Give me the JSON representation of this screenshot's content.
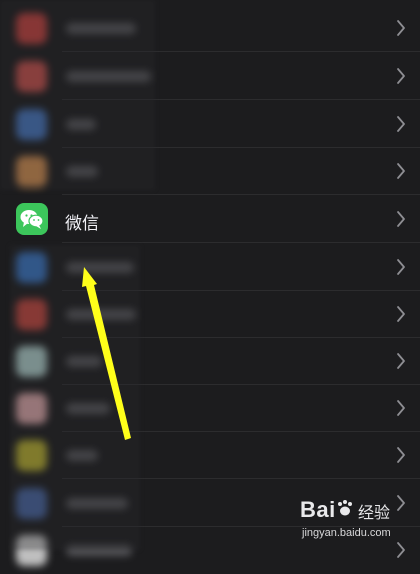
{
  "settings_list": {
    "rows": [
      {
        "kind": "blurred",
        "icon_color": "#d64541",
        "label_width": 70
      },
      {
        "kind": "blurred",
        "icon_color": "#d95550",
        "label_width": 85
      },
      {
        "kind": "blurred",
        "icon_color": "#4a7fd0",
        "label_width": 30
      },
      {
        "kind": "blurred",
        "icon_color": "#e59a55",
        "label_width": 32
      },
      {
        "kind": "focus",
        "label": "微信",
        "icon": "wechat-icon",
        "icon_color": "#3cc65b"
      },
      {
        "kind": "blurred",
        "icon_color": "#3c7fd6",
        "label_width": 68
      },
      {
        "kind": "blurred",
        "icon_color": "#d64a41",
        "label_width": 70
      },
      {
        "kind": "blurred",
        "icon_color": "#bfe3df",
        "label_width": 36
      },
      {
        "kind": "blurred",
        "icon_color": "#f1b6b8",
        "label_width": 44
      },
      {
        "kind": "blurred",
        "icon_color": "#c9c030",
        "label_width": 32
      },
      {
        "kind": "blurred",
        "icon_color": "#4c6db0",
        "label_width": 62
      },
      {
        "kind": "blurred",
        "icon_color": "#dcdcdc",
        "label_width": 66
      }
    ]
  },
  "annotation": {
    "color": "#ffff1a"
  },
  "watermark": {
    "brand_left": "Bai",
    "brand_right": "经验",
    "url": "jingyan.baidu.com"
  }
}
